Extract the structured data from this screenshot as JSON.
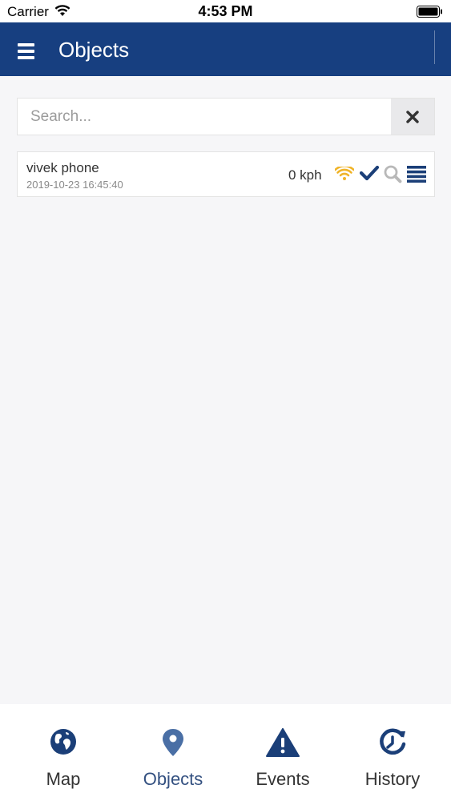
{
  "status_bar": {
    "carrier": "Carrier",
    "time": "4:53 PM"
  },
  "header": {
    "title": "Objects"
  },
  "search": {
    "placeholder": "Search...",
    "value": ""
  },
  "objects": [
    {
      "name": "vivek phone",
      "timestamp": "2019-10-23 16:45:40",
      "speed": "0 kph",
      "icons": [
        "signal-icon",
        "check-icon",
        "search-icon",
        "details-menu-icon"
      ]
    }
  ],
  "bottom_nav": {
    "items": [
      {
        "label": "Map",
        "icon": "globe-icon"
      },
      {
        "label": "Objects",
        "icon": "location-pin-icon",
        "active": true
      },
      {
        "label": "Events",
        "icon": "warning-icon"
      },
      {
        "label": "History",
        "icon": "history-clock-icon"
      }
    ]
  },
  "colors": {
    "header": "#173f80",
    "accent": "#1b3f78",
    "signal": "#f0b429",
    "background": "#f6f6f8"
  }
}
